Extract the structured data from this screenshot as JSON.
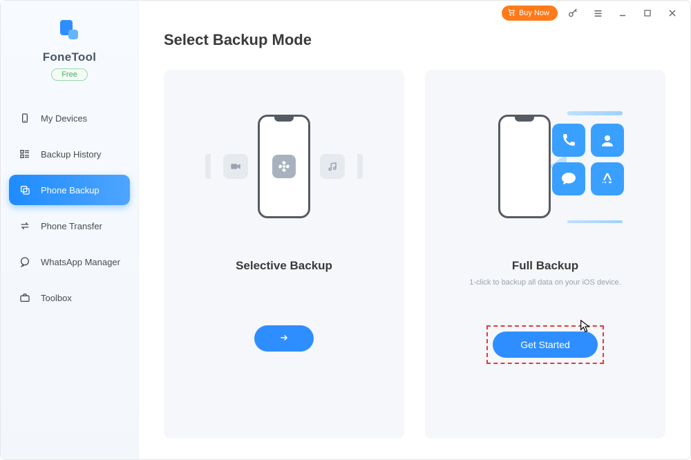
{
  "titlebar": {
    "buy_now_label": "Buy Now"
  },
  "brand": {
    "name": "FoneTool",
    "badge": "Free"
  },
  "sidebar": {
    "items": [
      {
        "label": "My Devices",
        "icon": "device-icon",
        "active": false
      },
      {
        "label": "Backup History",
        "icon": "history-icon",
        "active": false
      },
      {
        "label": "Phone Backup",
        "icon": "backup-icon",
        "active": true
      },
      {
        "label": "Phone Transfer",
        "icon": "transfer-icon",
        "active": false
      },
      {
        "label": "WhatsApp Manager",
        "icon": "chat-icon",
        "active": false
      },
      {
        "label": "Toolbox",
        "icon": "toolbox-icon",
        "active": false
      }
    ]
  },
  "page": {
    "title": "Select Backup Mode"
  },
  "cards": {
    "selective": {
      "title": "Selective Backup",
      "desc": "",
      "cta": "→"
    },
    "full": {
      "title": "Full Backup",
      "desc": "1-click to backup all data on your iOS device.",
      "cta": "Get Started",
      "apps": [
        {
          "name": "phone-app-icon",
          "color": "#3aa0ff"
        },
        {
          "name": "contact-app-icon",
          "color": "#3aa0ff"
        },
        {
          "name": "message-app-icon",
          "color": "#3aa0ff"
        },
        {
          "name": "appstore-icon",
          "color": "#3aa0ff"
        }
      ]
    }
  },
  "colors": {
    "accent": "#2f8eff",
    "buy": "#ff7a1a",
    "highlight": "#e53935"
  }
}
